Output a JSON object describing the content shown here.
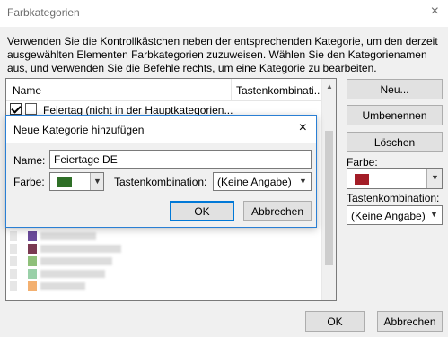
{
  "window": {
    "title": "Farbkategorien",
    "close_icon": "×"
  },
  "instructions": "Verwenden Sie die Kontrollkästchen neben der entsprechenden Kategorie, um den derzeit ausgewählten Elementen Farbkategorien zuzuweisen. Wählen Sie den Kategorienamen aus, und verwenden Sie die Befehle rechts, um eine Kategorie zu bearbeiten.",
  "list": {
    "columns": [
      "Name",
      "Tastenkombinati..."
    ],
    "rows": [
      {
        "checked": true,
        "label": "Feiertag (nicht in der Hauptkategorien..."
      }
    ]
  },
  "side": {
    "new_label": "Neu...",
    "rename_label": "Umbenennen",
    "delete_label": "Löschen",
    "color_label": "Farbe:",
    "color_value": "#a31d27",
    "shortcut_label": "Tastenkombination:",
    "shortcut_value": "(Keine Angabe)"
  },
  "footer": {
    "ok_label": "OK",
    "cancel_label": "Abbrechen"
  },
  "modal": {
    "title": "Neue Kategorie hinzufügen",
    "close_icon": "×",
    "name_label": "Name:",
    "name_value": "Feiertage DE",
    "color_label": "Farbe:",
    "color_value": "#2f6f27",
    "shortcut_label": "Tastenkombination:",
    "shortcut_value": "(Keine Angabe)",
    "ok_label": "OK",
    "cancel_label": "Abbrechen"
  },
  "icons": {
    "chevron": "chevron-down-icon",
    "close": "close-icon",
    "scroll_up": "scroll-up-icon"
  }
}
